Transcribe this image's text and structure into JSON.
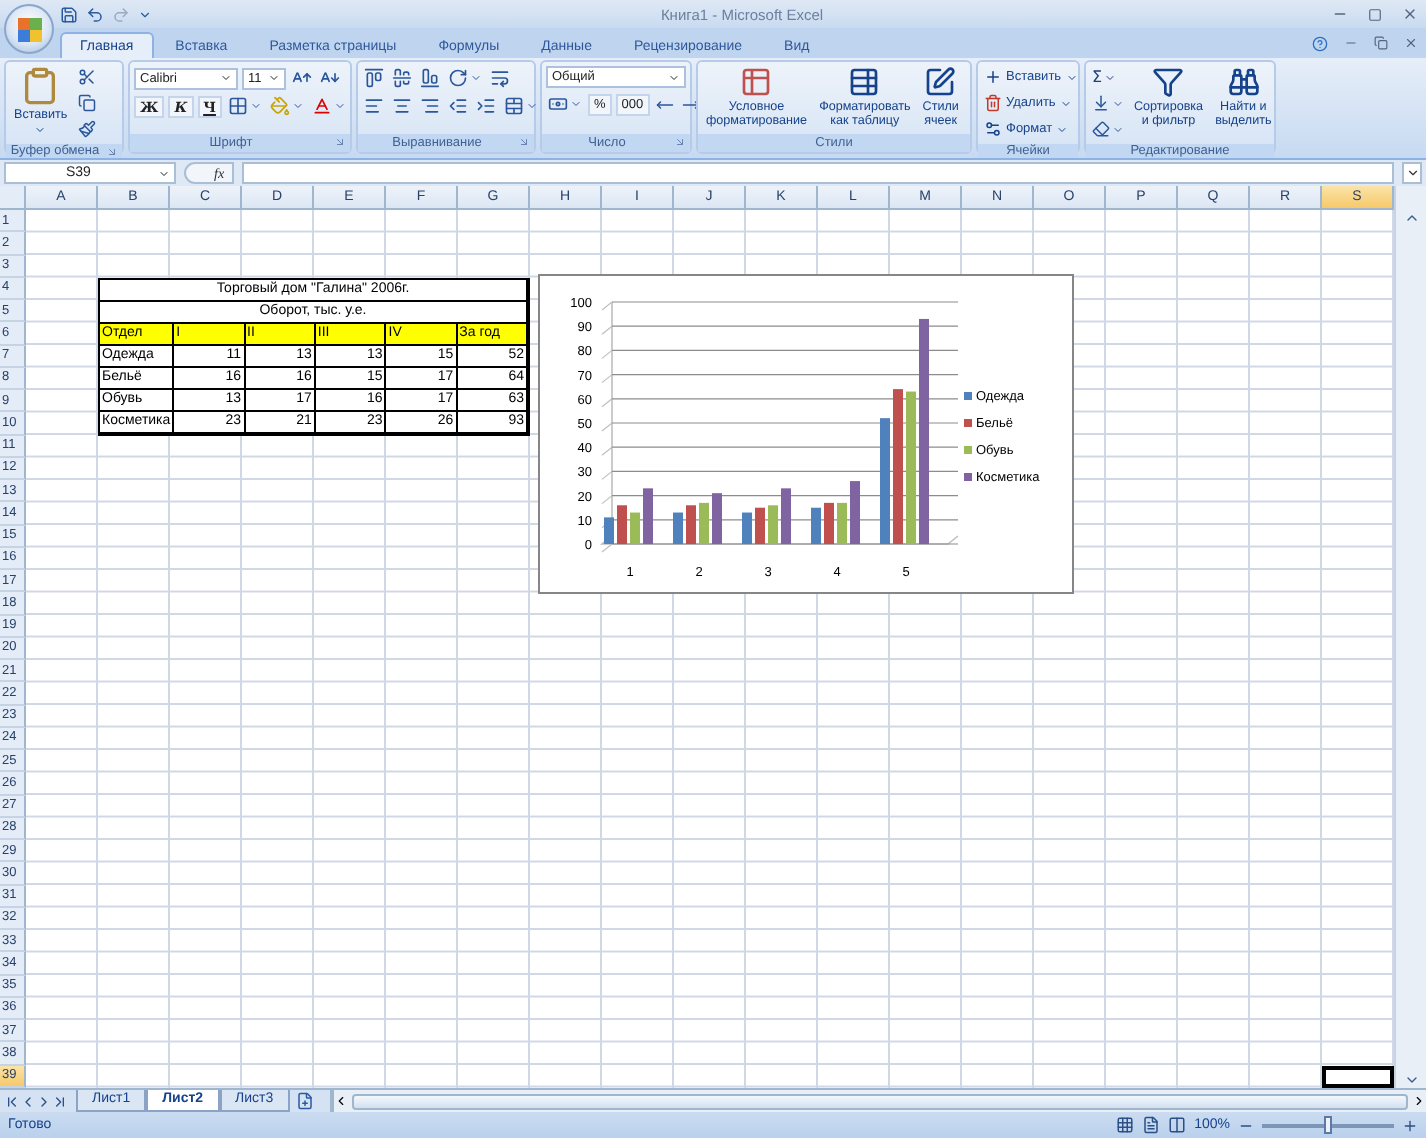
{
  "window": {
    "title": "Книга1 - Microsoft Excel"
  },
  "tabs": [
    {
      "label": "Главная",
      "selected": true
    },
    {
      "label": "Вставка",
      "selected": false
    },
    {
      "label": "Разметка страницы",
      "selected": false
    },
    {
      "label": "Формулы",
      "selected": false
    },
    {
      "label": "Данные",
      "selected": false
    },
    {
      "label": "Рецензирование",
      "selected": false
    },
    {
      "label": "Вид",
      "selected": false
    }
  ],
  "ribbon": [
    {
      "kind": "clipboard",
      "label": "Буфер обмена",
      "buttons": [
        "Вставить"
      ]
    },
    {
      "kind": "font",
      "label": "Шрифт",
      "font": "Calibri",
      "size": "11",
      "buttons": [
        "Ж",
        "К",
        "Ч"
      ]
    },
    {
      "kind": "alignment",
      "label": "Выравнивание"
    },
    {
      "kind": "number",
      "label": "Число",
      "format": "Общий",
      "buttons": [
        "%",
        "000"
      ]
    },
    {
      "kind": "styles",
      "label": "Стили",
      "buttons": [
        "Условное\nформатирование",
        "Форматировать\nкак таблицу",
        "Стили\nячеек"
      ]
    },
    {
      "kind": "cells",
      "label": "Ячейки",
      "buttons": [
        "Вставить",
        "Удалить",
        "Формат"
      ]
    },
    {
      "kind": "editing",
      "label": "Редактирование",
      "buttons": [
        "Σ",
        "Сортировка\nи фильтр",
        "Найти и\nвыделить"
      ]
    }
  ],
  "formula_bar": {
    "name_box": "S39",
    "function_label": "fx"
  },
  "columns": [
    {
      "label": "A",
      "selected": false
    },
    {
      "label": "B",
      "selected": false
    },
    {
      "label": "C",
      "selected": false
    },
    {
      "label": "D",
      "selected": false
    },
    {
      "label": "E",
      "selected": false
    },
    {
      "label": "F",
      "selected": false
    },
    {
      "label": "G",
      "selected": false
    },
    {
      "label": "H",
      "selected": false
    },
    {
      "label": "I",
      "selected": false
    },
    {
      "label": "J",
      "selected": false
    },
    {
      "label": "K",
      "selected": false
    },
    {
      "label": "L",
      "selected": false
    },
    {
      "label": "M",
      "selected": false
    },
    {
      "label": "N",
      "selected": false
    },
    {
      "label": "O",
      "selected": false
    },
    {
      "label": "P",
      "selected": false
    },
    {
      "label": "Q",
      "selected": false
    },
    {
      "label": "R",
      "selected": false
    },
    {
      "label": "S",
      "selected": true
    }
  ],
  "rows": [
    {
      "label": "1",
      "selected": false
    },
    {
      "label": "2",
      "selected": false
    },
    {
      "label": "3",
      "selected": false
    },
    {
      "label": "4",
      "selected": false
    },
    {
      "label": "5",
      "selected": false
    },
    {
      "label": "6",
      "selected": false
    },
    {
      "label": "7",
      "selected": false
    },
    {
      "label": "8",
      "selected": false
    },
    {
      "label": "9",
      "selected": false
    },
    {
      "label": "10",
      "selected": false
    },
    {
      "label": "11",
      "selected": false
    },
    {
      "label": "12",
      "selected": false
    },
    {
      "label": "13",
      "selected": false
    },
    {
      "label": "14",
      "selected": false
    },
    {
      "label": "15",
      "selected": false
    },
    {
      "label": "16",
      "selected": false
    },
    {
      "label": "17",
      "selected": false
    },
    {
      "label": "18",
      "selected": false
    },
    {
      "label": "19",
      "selected": false
    },
    {
      "label": "20",
      "selected": false
    },
    {
      "label": "21",
      "selected": false
    },
    {
      "label": "22",
      "selected": false
    },
    {
      "label": "23",
      "selected": false
    },
    {
      "label": "24",
      "selected": false
    },
    {
      "label": "25",
      "selected": false
    },
    {
      "label": "26",
      "selected": false
    },
    {
      "label": "27",
      "selected": false
    },
    {
      "label": "28",
      "selected": false
    },
    {
      "label": "29",
      "selected": false
    },
    {
      "label": "30",
      "selected": false
    },
    {
      "label": "31",
      "selected": false
    },
    {
      "label": "32",
      "selected": false
    },
    {
      "label": "33",
      "selected": false
    },
    {
      "label": "34",
      "selected": false
    },
    {
      "label": "35",
      "selected": false
    },
    {
      "label": "36",
      "selected": false
    },
    {
      "label": "37",
      "selected": false
    },
    {
      "label": "38",
      "selected": false
    },
    {
      "label": "39",
      "selected": true
    }
  ],
  "table": {
    "title": "Торговый дом \"Галина\" 2006г.",
    "subtitle": "Оборот, тыс. у.е.",
    "header": [
      "Отдел",
      "I",
      "II",
      "III",
      "IV",
      "За год"
    ],
    "rows": [
      [
        "Одежда",
        "11",
        "13",
        "13",
        "15",
        "52"
      ],
      [
        "Бельё",
        "16",
        "16",
        "15",
        "17",
        "64"
      ],
      [
        "Обувь",
        "13",
        "17",
        "16",
        "17",
        "63"
      ],
      [
        "Косметика",
        "23",
        "21",
        "23",
        "26",
        "93"
      ]
    ]
  },
  "chart": {
    "chart_data": {
      "type": "bar",
      "legend": true,
      "grid": true,
      "categories": [
        "1",
        "2",
        "3",
        "4",
        "5"
      ],
      "ylim": [
        0,
        100
      ],
      "yticks": [
        0,
        10,
        20,
        30,
        40,
        50,
        60,
        70,
        80,
        90,
        100
      ],
      "series": [
        {
          "name": "Одежда",
          "color": "#4f81bd",
          "values": [
            11,
            13,
            13,
            15,
            52
          ]
        },
        {
          "name": "Бельё",
          "color": "#c0504d",
          "values": [
            16,
            16,
            15,
            17,
            64
          ]
        },
        {
          "name": "Обувь",
          "color": "#9bbb59",
          "values": [
            13,
            17,
            16,
            17,
            63
          ]
        },
        {
          "name": "Косметика",
          "color": "#8064a2",
          "values": [
            23,
            21,
            23,
            26,
            93
          ]
        }
      ]
    }
  },
  "sheet_tabs": [
    {
      "label": "Лист1",
      "selected": false
    },
    {
      "label": "Лист2",
      "selected": true
    },
    {
      "label": "Лист3",
      "selected": false
    }
  ],
  "status_bar": {
    "text": "Готово",
    "zoom": {
      "reading": "100%",
      "level": 0.5
    }
  }
}
